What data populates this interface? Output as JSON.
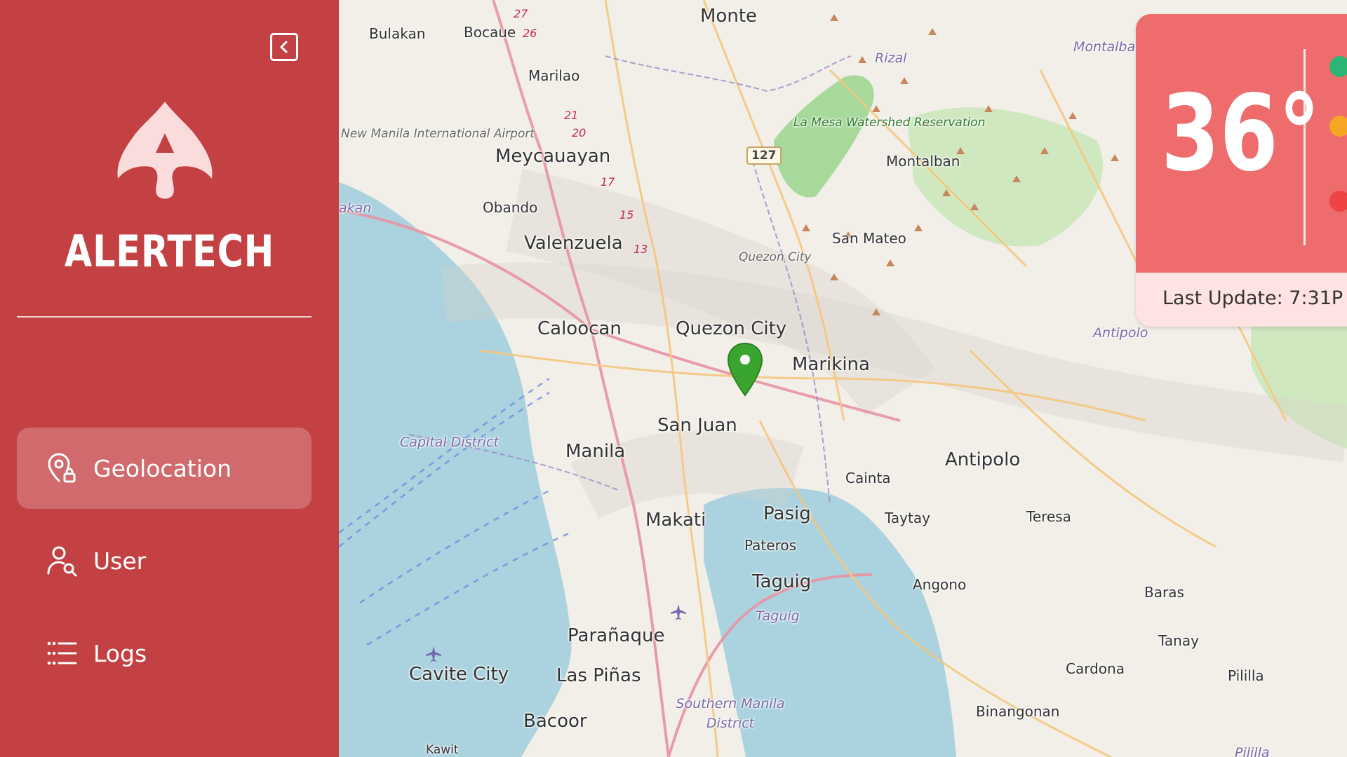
{
  "sidebar": {
    "brand": "ALERTECH",
    "collapse_icon": "chevron-left-icon",
    "nav": [
      {
        "label": "Geolocation",
        "icon": "location-lock-icon",
        "active": true
      },
      {
        "label": "User",
        "icon": "user-search-icon",
        "active": false
      },
      {
        "label": "Logs",
        "icon": "list-icon",
        "active": false
      }
    ],
    "colors": {
      "background": "#c34143",
      "logo": "#fadcdc"
    }
  },
  "map": {
    "labels_large": [
      "Monte",
      "Meycauayan",
      "Valenzuela",
      "Caloocan",
      "Quezon City",
      "Marikina",
      "San Juan",
      "Manila",
      "Antipolo",
      "Makati",
      "Pasig",
      "Taguig",
      "Parañaque",
      "Cavite City",
      "Las Piñas",
      "Bacoor"
    ],
    "labels_medium": [
      "Bulakan",
      "Bocaue",
      "Marilao",
      "Obando",
      "Montalban",
      "San Mateo",
      "Cainta",
      "Taytay",
      "Teresa",
      "Pateros",
      "Angono",
      "Baras",
      "Tanay",
      "Cardona",
      "Pililla",
      "Binangonan",
      "Kawit"
    ],
    "labels_italic": [
      "Rizal",
      "Montalban",
      "Antipolo",
      "Quezon City",
      "Capital District",
      "Taguig",
      "Southern Manila District",
      "akan",
      "Pililla"
    ],
    "airport": "New Manila International Airport",
    "watershed": "La Mesa Watershed Reservation",
    "road_numbers": [
      "27",
      "26",
      "21",
      "20",
      "17",
      "15",
      "13"
    ],
    "highway_shield": "127",
    "marker_color": "#3aa52e"
  },
  "weather": {
    "temperature": "36°",
    "last_update": "Last Update: 7:31P",
    "status_colors": [
      "#2bb673",
      "#f5a623",
      "#ef4444"
    ],
    "card_color": "#ee6c6c"
  }
}
